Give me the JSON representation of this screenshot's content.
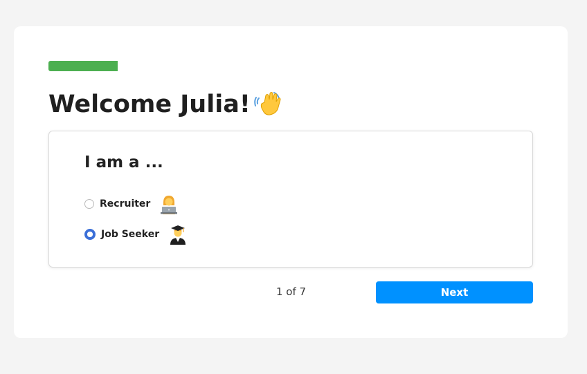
{
  "progress": {
    "step": 1,
    "total": 7,
    "fraction": 0.143,
    "color": "#4caf50"
  },
  "header": {
    "title": "Welcome Julia!",
    "emoji_icon": "waving-hand-icon"
  },
  "question": {
    "prompt": "I am a ...",
    "options": [
      {
        "label": "Recruiter",
        "icon": "woman-technologist-icon",
        "selected": false
      },
      {
        "label": "Job Seeker",
        "icon": "graduate-icon",
        "selected": true
      }
    ]
  },
  "footer": {
    "pager": "1 of 7",
    "next_label": "Next"
  },
  "colors": {
    "accent": "#0091ff",
    "radio": "#3b6fd8",
    "page_bg": "#f4f4f4"
  }
}
